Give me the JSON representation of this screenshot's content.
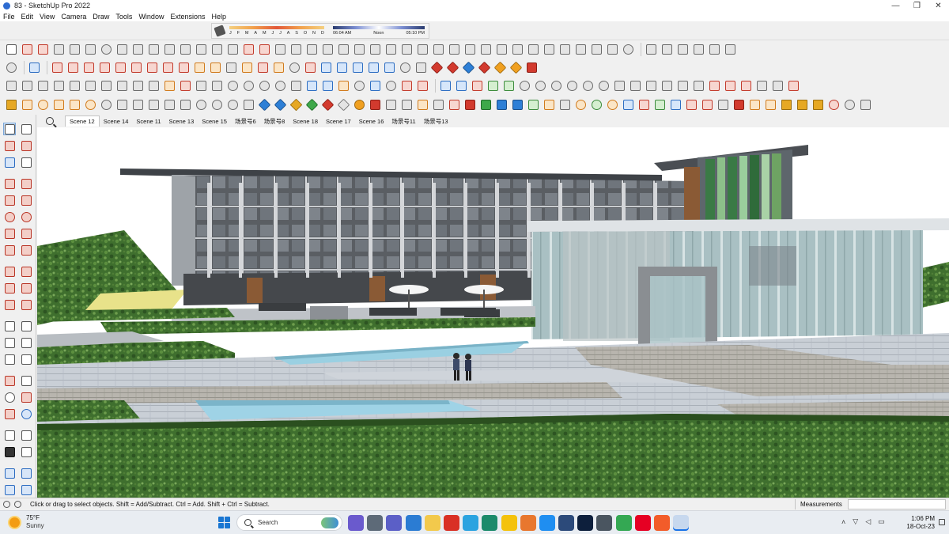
{
  "window": {
    "title": "83 - SketchUp Pro 2022",
    "controls": {
      "minimize": "—",
      "maximize": "❐",
      "close": "✕"
    }
  },
  "menu": [
    "File",
    "Edit",
    "View",
    "Camera",
    "Draw",
    "Tools",
    "Window",
    "Extensions",
    "Help"
  ],
  "shadow_settings": {
    "months": [
      "J",
      "F",
      "M",
      "A",
      "M",
      "J",
      "J",
      "A",
      "S",
      "O",
      "N",
      "D"
    ],
    "time_start": "06:04 AM",
    "time_mid": "Noon",
    "time_end": "05:10 PM"
  },
  "scenes": [
    "Scene 12",
    "Scene 14",
    "Scene 11",
    "Scene 13",
    "Scene 15",
    "场景号6",
    "场景号8",
    "Scene 18",
    "Scene 17",
    "Scene 16",
    "场景号11",
    "场景号13"
  ],
  "active_scene": "Scene 12",
  "status": {
    "hint": "Click or drag to select objects. Shift = Add/Subtract. Ctrl = Add. Shift + Ctrl = Subtract.",
    "measurements_label": "Measurements",
    "measurements_value": ""
  },
  "taskbar": {
    "weather_temp": "75°F",
    "weather_cond": "Sunny",
    "search_label": "Search",
    "time": "1:06 PM",
    "date": "18-Oct-23",
    "tray_up_arrow": "˄",
    "wifi": "▽",
    "volume": "◁",
    "battery": "▭"
  },
  "colors": {
    "accent": "#1a73e8",
    "grass": "#3c6e2a",
    "paving": "#c9cfd6",
    "water": "#9fd3e6"
  }
}
